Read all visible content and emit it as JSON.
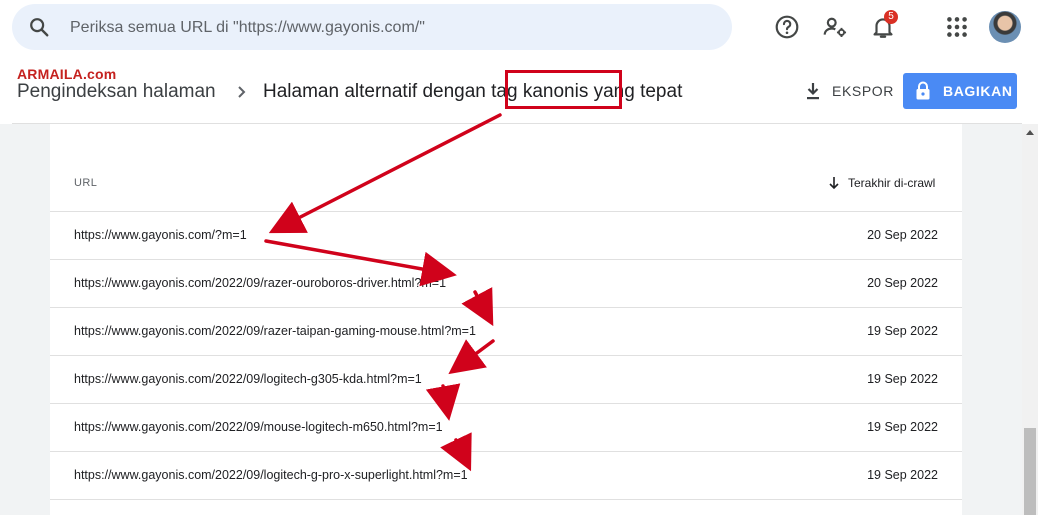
{
  "search": {
    "placeholder": "Periksa semua URL di \"https://www.gayonis.com/\""
  },
  "topbar": {
    "icons": [
      "help-icon",
      "manage-users-icon",
      "notifications-icon",
      "apps-grid-icon"
    ],
    "notification_count": "5"
  },
  "watermark": "ARMAILA.com",
  "breadcrumb": {
    "parent": "Pengindeksan halaman",
    "current": "Halaman alternatif dengan tag kanonis yang tepat"
  },
  "actions": {
    "export_label": "EKSPOR",
    "share_label": "BAGIKAN"
  },
  "table": {
    "columns": {
      "url": "URL",
      "last_crawled": "Terakhir di-crawl"
    },
    "rows": [
      {
        "url": "https://www.gayonis.com/?m=1",
        "date": "20 Sep 2022"
      },
      {
        "url": "https://www.gayonis.com/2022/09/razer-ouroboros-driver.html?m=1",
        "date": "20 Sep 2022"
      },
      {
        "url": "https://www.gayonis.com/2022/09/razer-taipan-gaming-mouse.html?m=1",
        "date": "19 Sep 2022"
      },
      {
        "url": "https://www.gayonis.com/2022/09/logitech-g305-kda.html?m=1",
        "date": "19 Sep 2022"
      },
      {
        "url": "https://www.gayonis.com/2022/09/mouse-logitech-m650.html?m=1",
        "date": "19 Sep 2022"
      },
      {
        "url": "https://www.gayonis.com/2022/09/logitech-g-pro-x-superlight.html?m=1",
        "date": "19 Sep 2022"
      }
    ]
  },
  "colors": {
    "accent": "#4a8af4",
    "annotation": "#d0021b",
    "search_bg": "#eaf1fb",
    "badge": "#d93025"
  }
}
